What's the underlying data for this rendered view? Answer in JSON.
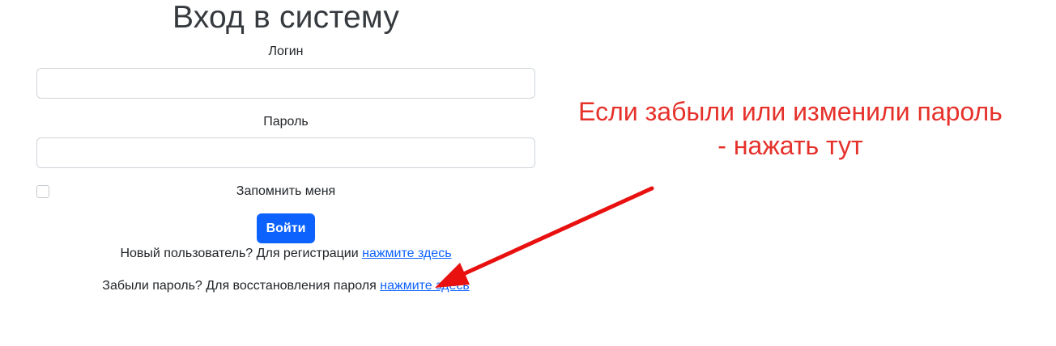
{
  "login_form": {
    "title": "Вход в систему",
    "login_label": "Логин",
    "login_value": "",
    "password_label": "Пароль",
    "password_value": "",
    "remember_label": "Запомнить меня",
    "remember_checked": false,
    "submit_label": "Войти",
    "register_text": "Новый пользователь? Для регистрации",
    "register_link": "нажмите здесь",
    "forgot_text": "Забыли пароль? Для восстановления пароля",
    "forgot_link": "нажмите здесь"
  },
  "annotation": {
    "line1": "Если забыли или изменили пароль",
    "line2": "- нажать тут",
    "color": "#e6312b"
  },
  "colors": {
    "primary": "#0d62fd",
    "text": "#212529",
    "border": "#ced4da",
    "annotation_arrow": "#e8110f"
  }
}
